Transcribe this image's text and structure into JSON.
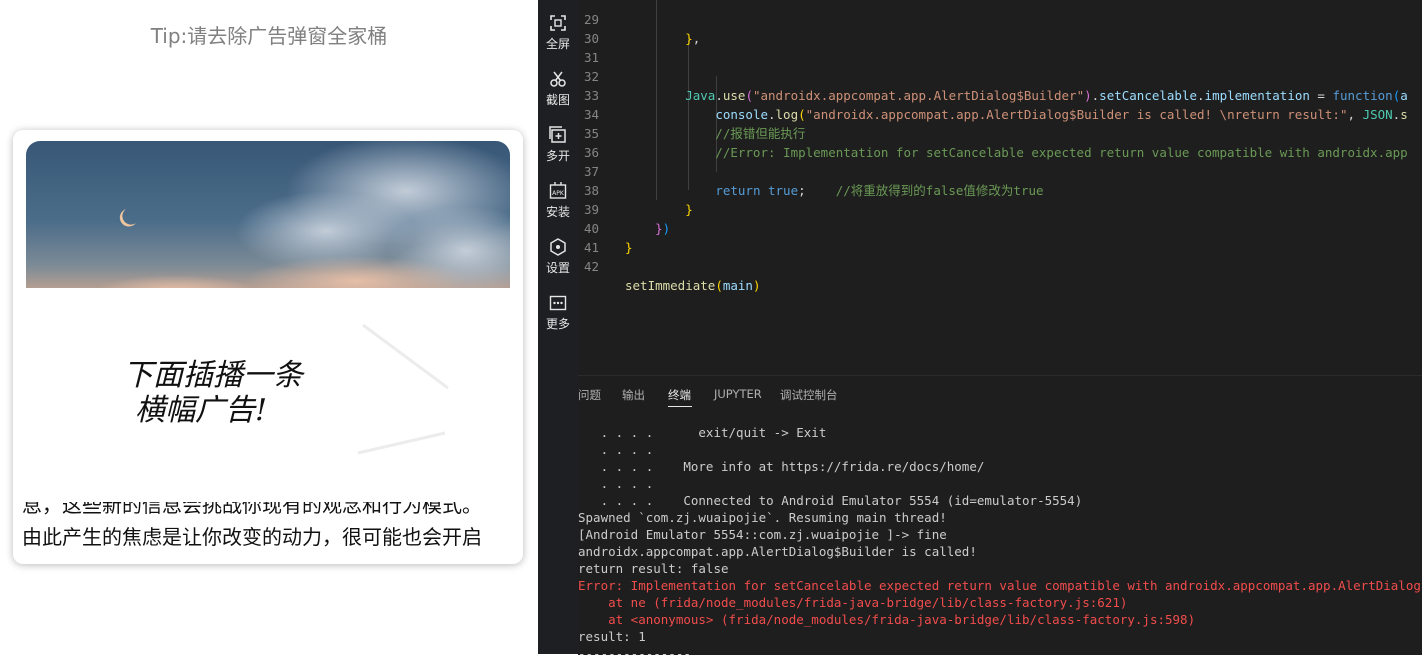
{
  "phone": {
    "tip": "Tip:请去除广告弹窗全家桶",
    "banner_handwriting_line1": "下面插播一条",
    "banner_handwriting_line2": "横幅广告!",
    "article_line_partial": "息，这些新的信息会挑战你现有的观念和行为模式。",
    "article_line_full": "由此产生的焦虑是让你改变的动力，很可能也会开启"
  },
  "activity_bar": [
    {
      "icon": "fullscreen-icon",
      "label": "全屏"
    },
    {
      "icon": "scissors-icon",
      "label": "截图"
    },
    {
      "icon": "multi-window-icon",
      "label": "多开"
    },
    {
      "icon": "apk-icon",
      "label": "安装"
    },
    {
      "icon": "settings-icon",
      "label": "设置"
    },
    {
      "icon": "more-icon",
      "label": "更多"
    }
  ],
  "editor": {
    "lines": [
      {
        "n": "29",
        "text": "        },"
      },
      {
        "n": "30",
        "text": ""
      },
      {
        "n": "31",
        "text": ""
      },
      {
        "n": "32",
        "text": "        Java.use(\"androidx.appcompat.app.AlertDialog$Builder\").setCancelable.implementation = function(a"
      },
      {
        "n": "33",
        "text": "            console.log(\"androidx.appcompat.app.AlertDialog$Builder is called! \\nreturn result:\", JSON.s"
      },
      {
        "n": "34",
        "text": "            //报错但能执行"
      },
      {
        "n": "35",
        "text": "            //Error: Implementation for setCancelable expected return value compatible with androidx.app"
      },
      {
        "n": "36",
        "text": ""
      },
      {
        "n": "37",
        "text": "            return true;    //将重放得到的false值修改为true"
      },
      {
        "n": "38",
        "text": "        }"
      },
      {
        "n": "39",
        "text": "    })"
      },
      {
        "n": "40",
        "text": "}"
      },
      {
        "n": "41",
        "text": ""
      },
      {
        "n": "42",
        "text": "setImmediate(main)"
      }
    ]
  },
  "panel": {
    "tabs": [
      "问题",
      "输出",
      "终端",
      "JUPYTER",
      "调试控制台"
    ],
    "active_tab": "终端",
    "terminal": [
      {
        "text": "   . . . .      exit/quit -> Exit",
        "type": "normal"
      },
      {
        "text": "   . . . .",
        "type": "normal"
      },
      {
        "text": "   . . . .    More info at https://frida.re/docs/home/",
        "type": "normal"
      },
      {
        "text": "   . . . .",
        "type": "normal"
      },
      {
        "text": "   . . . .    Connected to Android Emulator 5554 (id=emulator-5554)",
        "type": "normal"
      },
      {
        "text": "Spawned `com.zj.wuaipojie`. Resuming main thread!",
        "type": "normal"
      },
      {
        "text": "[Android Emulator 5554::com.zj.wuaipojie ]-> fine",
        "type": "normal"
      },
      {
        "text": "androidx.appcompat.app.AlertDialog$Builder is called!",
        "type": "normal"
      },
      {
        "text": "return result: false",
        "type": "normal"
      },
      {
        "text": "Error: Implementation for setCancelable expected return value compatible with androidx.appcompat.app.AlertDialog$Builder",
        "type": "error"
      },
      {
        "text": "    at ne (frida/node_modules/frida-java-bridge/lib/class-factory.js:621)",
        "type": "error"
      },
      {
        "text": "    at <anonymous> (frida/node_modules/frida-java-bridge/lib/class-factory.js:598)",
        "type": "error"
      },
      {
        "text": "result: 1",
        "type": "normal"
      },
      {
        "text": "---------------",
        "type": "normal"
      }
    ]
  }
}
